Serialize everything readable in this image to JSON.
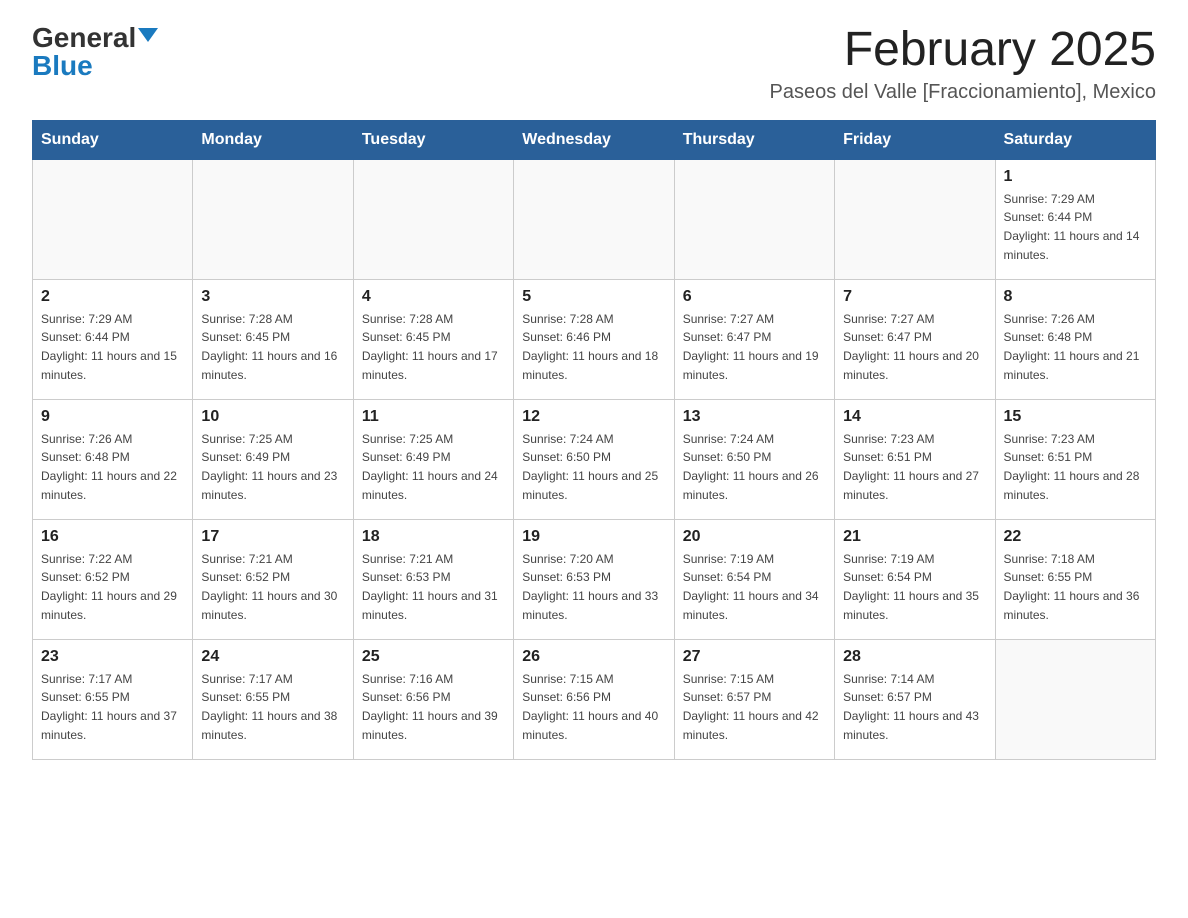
{
  "logo": {
    "general": "General",
    "blue": "Blue"
  },
  "title": "February 2025",
  "location": "Paseos del Valle [Fraccionamiento], Mexico",
  "days_of_week": [
    "Sunday",
    "Monday",
    "Tuesday",
    "Wednesday",
    "Thursday",
    "Friday",
    "Saturday"
  ],
  "weeks": [
    [
      {
        "day": "",
        "info": ""
      },
      {
        "day": "",
        "info": ""
      },
      {
        "day": "",
        "info": ""
      },
      {
        "day": "",
        "info": ""
      },
      {
        "day": "",
        "info": ""
      },
      {
        "day": "",
        "info": ""
      },
      {
        "day": "1",
        "info": "Sunrise: 7:29 AM\nSunset: 6:44 PM\nDaylight: 11 hours and 14 minutes."
      }
    ],
    [
      {
        "day": "2",
        "info": "Sunrise: 7:29 AM\nSunset: 6:44 PM\nDaylight: 11 hours and 15 minutes."
      },
      {
        "day": "3",
        "info": "Sunrise: 7:28 AM\nSunset: 6:45 PM\nDaylight: 11 hours and 16 minutes."
      },
      {
        "day": "4",
        "info": "Sunrise: 7:28 AM\nSunset: 6:45 PM\nDaylight: 11 hours and 17 minutes."
      },
      {
        "day": "5",
        "info": "Sunrise: 7:28 AM\nSunset: 6:46 PM\nDaylight: 11 hours and 18 minutes."
      },
      {
        "day": "6",
        "info": "Sunrise: 7:27 AM\nSunset: 6:47 PM\nDaylight: 11 hours and 19 minutes."
      },
      {
        "day": "7",
        "info": "Sunrise: 7:27 AM\nSunset: 6:47 PM\nDaylight: 11 hours and 20 minutes."
      },
      {
        "day": "8",
        "info": "Sunrise: 7:26 AM\nSunset: 6:48 PM\nDaylight: 11 hours and 21 minutes."
      }
    ],
    [
      {
        "day": "9",
        "info": "Sunrise: 7:26 AM\nSunset: 6:48 PM\nDaylight: 11 hours and 22 minutes."
      },
      {
        "day": "10",
        "info": "Sunrise: 7:25 AM\nSunset: 6:49 PM\nDaylight: 11 hours and 23 minutes."
      },
      {
        "day": "11",
        "info": "Sunrise: 7:25 AM\nSunset: 6:49 PM\nDaylight: 11 hours and 24 minutes."
      },
      {
        "day": "12",
        "info": "Sunrise: 7:24 AM\nSunset: 6:50 PM\nDaylight: 11 hours and 25 minutes."
      },
      {
        "day": "13",
        "info": "Sunrise: 7:24 AM\nSunset: 6:50 PM\nDaylight: 11 hours and 26 minutes."
      },
      {
        "day": "14",
        "info": "Sunrise: 7:23 AM\nSunset: 6:51 PM\nDaylight: 11 hours and 27 minutes."
      },
      {
        "day": "15",
        "info": "Sunrise: 7:23 AM\nSunset: 6:51 PM\nDaylight: 11 hours and 28 minutes."
      }
    ],
    [
      {
        "day": "16",
        "info": "Sunrise: 7:22 AM\nSunset: 6:52 PM\nDaylight: 11 hours and 29 minutes."
      },
      {
        "day": "17",
        "info": "Sunrise: 7:21 AM\nSunset: 6:52 PM\nDaylight: 11 hours and 30 minutes."
      },
      {
        "day": "18",
        "info": "Sunrise: 7:21 AM\nSunset: 6:53 PM\nDaylight: 11 hours and 31 minutes."
      },
      {
        "day": "19",
        "info": "Sunrise: 7:20 AM\nSunset: 6:53 PM\nDaylight: 11 hours and 33 minutes."
      },
      {
        "day": "20",
        "info": "Sunrise: 7:19 AM\nSunset: 6:54 PM\nDaylight: 11 hours and 34 minutes."
      },
      {
        "day": "21",
        "info": "Sunrise: 7:19 AM\nSunset: 6:54 PM\nDaylight: 11 hours and 35 minutes."
      },
      {
        "day": "22",
        "info": "Sunrise: 7:18 AM\nSunset: 6:55 PM\nDaylight: 11 hours and 36 minutes."
      }
    ],
    [
      {
        "day": "23",
        "info": "Sunrise: 7:17 AM\nSunset: 6:55 PM\nDaylight: 11 hours and 37 minutes."
      },
      {
        "day": "24",
        "info": "Sunrise: 7:17 AM\nSunset: 6:55 PM\nDaylight: 11 hours and 38 minutes."
      },
      {
        "day": "25",
        "info": "Sunrise: 7:16 AM\nSunset: 6:56 PM\nDaylight: 11 hours and 39 minutes."
      },
      {
        "day": "26",
        "info": "Sunrise: 7:15 AM\nSunset: 6:56 PM\nDaylight: 11 hours and 40 minutes."
      },
      {
        "day": "27",
        "info": "Sunrise: 7:15 AM\nSunset: 6:57 PM\nDaylight: 11 hours and 42 minutes."
      },
      {
        "day": "28",
        "info": "Sunrise: 7:14 AM\nSunset: 6:57 PM\nDaylight: 11 hours and 43 minutes."
      },
      {
        "day": "",
        "info": ""
      }
    ]
  ]
}
